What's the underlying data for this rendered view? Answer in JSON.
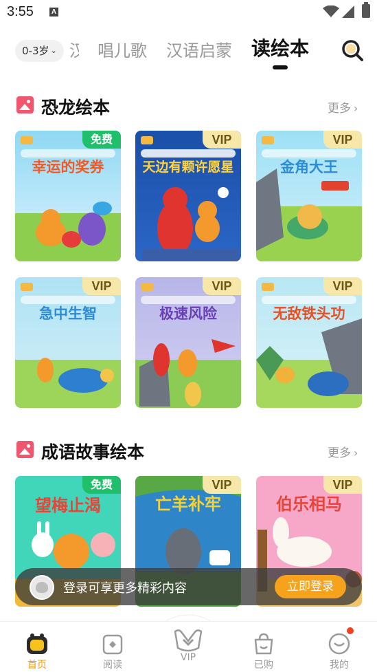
{
  "status_bar": {
    "time": "3:55",
    "notification_letter": "A"
  },
  "top_tabs": {
    "age_filter": "0-3岁",
    "partial_tab": "汉",
    "tabs": [
      {
        "label": "唱儿歌"
      },
      {
        "label": "汉语启蒙"
      },
      {
        "label": "读绘本"
      }
    ],
    "active_tab": "读绘本"
  },
  "sections": [
    {
      "title": "恐龙绘本",
      "more": "更多",
      "books": [
        {
          "title": "幸运的奖券",
          "badge": "免费"
        },
        {
          "title": "天边有颗许愿星",
          "badge": "VIP"
        },
        {
          "title": "金角大王",
          "badge": "VIP"
        },
        {
          "title": "急中生智",
          "badge": "VIP"
        },
        {
          "title": "极速风险",
          "badge": "VIP"
        },
        {
          "title": "无敌铁头功",
          "badge": "VIP"
        }
      ]
    },
    {
      "title": "成语故事绘本",
      "more": "更多",
      "books": [
        {
          "title": "望梅止渴",
          "badge": "免费"
        },
        {
          "title": "亡羊补牢",
          "badge": "VIP"
        },
        {
          "title": "伯乐相马",
          "badge": "VIP"
        }
      ]
    }
  ],
  "login_banner": {
    "text": "登录可享更多精彩内容",
    "button": "立即登录"
  },
  "bottom_nav": [
    {
      "label": "首页",
      "active": true
    },
    {
      "label": "阅读",
      "active": false
    },
    {
      "label": "VIP",
      "active": false
    },
    {
      "label": "已购",
      "active": false
    },
    {
      "label": "我的",
      "active": false
    }
  ],
  "colors": {
    "accent": "#f39a11",
    "vip_badge": "#f7e7a8",
    "free_badge": "#1fbf6b",
    "section_icon": "#f0566d"
  }
}
